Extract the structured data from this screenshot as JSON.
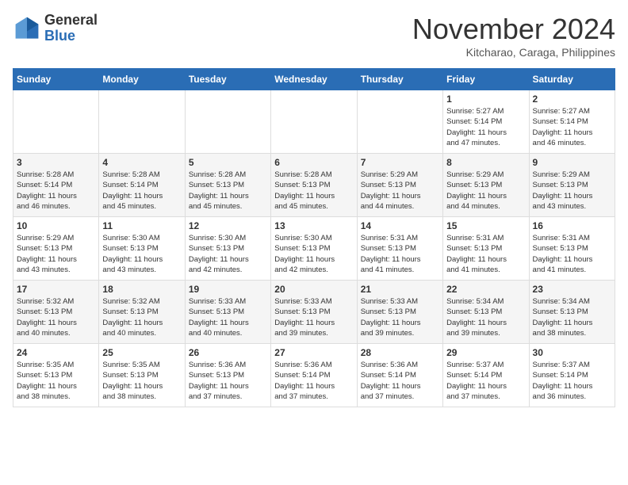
{
  "header": {
    "logo": {
      "general": "General",
      "blue": "Blue"
    },
    "title": "November 2024",
    "location": "Kitcharao, Caraga, Philippines"
  },
  "calendar": {
    "weekdays": [
      "Sunday",
      "Monday",
      "Tuesday",
      "Wednesday",
      "Thursday",
      "Friday",
      "Saturday"
    ],
    "weeks": [
      [
        {
          "day": "",
          "info": ""
        },
        {
          "day": "",
          "info": ""
        },
        {
          "day": "",
          "info": ""
        },
        {
          "day": "",
          "info": ""
        },
        {
          "day": "",
          "info": ""
        },
        {
          "day": "1",
          "info": "Sunrise: 5:27 AM\nSunset: 5:14 PM\nDaylight: 11 hours\nand 47 minutes."
        },
        {
          "day": "2",
          "info": "Sunrise: 5:27 AM\nSunset: 5:14 PM\nDaylight: 11 hours\nand 46 minutes."
        }
      ],
      [
        {
          "day": "3",
          "info": "Sunrise: 5:28 AM\nSunset: 5:14 PM\nDaylight: 11 hours\nand 46 minutes."
        },
        {
          "day": "4",
          "info": "Sunrise: 5:28 AM\nSunset: 5:14 PM\nDaylight: 11 hours\nand 45 minutes."
        },
        {
          "day": "5",
          "info": "Sunrise: 5:28 AM\nSunset: 5:13 PM\nDaylight: 11 hours\nand 45 minutes."
        },
        {
          "day": "6",
          "info": "Sunrise: 5:28 AM\nSunset: 5:13 PM\nDaylight: 11 hours\nand 45 minutes."
        },
        {
          "day": "7",
          "info": "Sunrise: 5:29 AM\nSunset: 5:13 PM\nDaylight: 11 hours\nand 44 minutes."
        },
        {
          "day": "8",
          "info": "Sunrise: 5:29 AM\nSunset: 5:13 PM\nDaylight: 11 hours\nand 44 minutes."
        },
        {
          "day": "9",
          "info": "Sunrise: 5:29 AM\nSunset: 5:13 PM\nDaylight: 11 hours\nand 43 minutes."
        }
      ],
      [
        {
          "day": "10",
          "info": "Sunrise: 5:29 AM\nSunset: 5:13 PM\nDaylight: 11 hours\nand 43 minutes."
        },
        {
          "day": "11",
          "info": "Sunrise: 5:30 AM\nSunset: 5:13 PM\nDaylight: 11 hours\nand 43 minutes."
        },
        {
          "day": "12",
          "info": "Sunrise: 5:30 AM\nSunset: 5:13 PM\nDaylight: 11 hours\nand 42 minutes."
        },
        {
          "day": "13",
          "info": "Sunrise: 5:30 AM\nSunset: 5:13 PM\nDaylight: 11 hours\nand 42 minutes."
        },
        {
          "day": "14",
          "info": "Sunrise: 5:31 AM\nSunset: 5:13 PM\nDaylight: 11 hours\nand 41 minutes."
        },
        {
          "day": "15",
          "info": "Sunrise: 5:31 AM\nSunset: 5:13 PM\nDaylight: 11 hours\nand 41 minutes."
        },
        {
          "day": "16",
          "info": "Sunrise: 5:31 AM\nSunset: 5:13 PM\nDaylight: 11 hours\nand 41 minutes."
        }
      ],
      [
        {
          "day": "17",
          "info": "Sunrise: 5:32 AM\nSunset: 5:13 PM\nDaylight: 11 hours\nand 40 minutes."
        },
        {
          "day": "18",
          "info": "Sunrise: 5:32 AM\nSunset: 5:13 PM\nDaylight: 11 hours\nand 40 minutes."
        },
        {
          "day": "19",
          "info": "Sunrise: 5:33 AM\nSunset: 5:13 PM\nDaylight: 11 hours\nand 40 minutes."
        },
        {
          "day": "20",
          "info": "Sunrise: 5:33 AM\nSunset: 5:13 PM\nDaylight: 11 hours\nand 39 minutes."
        },
        {
          "day": "21",
          "info": "Sunrise: 5:33 AM\nSunset: 5:13 PM\nDaylight: 11 hours\nand 39 minutes."
        },
        {
          "day": "22",
          "info": "Sunrise: 5:34 AM\nSunset: 5:13 PM\nDaylight: 11 hours\nand 39 minutes."
        },
        {
          "day": "23",
          "info": "Sunrise: 5:34 AM\nSunset: 5:13 PM\nDaylight: 11 hours\nand 38 minutes."
        }
      ],
      [
        {
          "day": "24",
          "info": "Sunrise: 5:35 AM\nSunset: 5:13 PM\nDaylight: 11 hours\nand 38 minutes."
        },
        {
          "day": "25",
          "info": "Sunrise: 5:35 AM\nSunset: 5:13 PM\nDaylight: 11 hours\nand 38 minutes."
        },
        {
          "day": "26",
          "info": "Sunrise: 5:36 AM\nSunset: 5:13 PM\nDaylight: 11 hours\nand 37 minutes."
        },
        {
          "day": "27",
          "info": "Sunrise: 5:36 AM\nSunset: 5:14 PM\nDaylight: 11 hours\nand 37 minutes."
        },
        {
          "day": "28",
          "info": "Sunrise: 5:36 AM\nSunset: 5:14 PM\nDaylight: 11 hours\nand 37 minutes."
        },
        {
          "day": "29",
          "info": "Sunrise: 5:37 AM\nSunset: 5:14 PM\nDaylight: 11 hours\nand 37 minutes."
        },
        {
          "day": "30",
          "info": "Sunrise: 5:37 AM\nSunset: 5:14 PM\nDaylight: 11 hours\nand 36 minutes."
        }
      ]
    ]
  }
}
